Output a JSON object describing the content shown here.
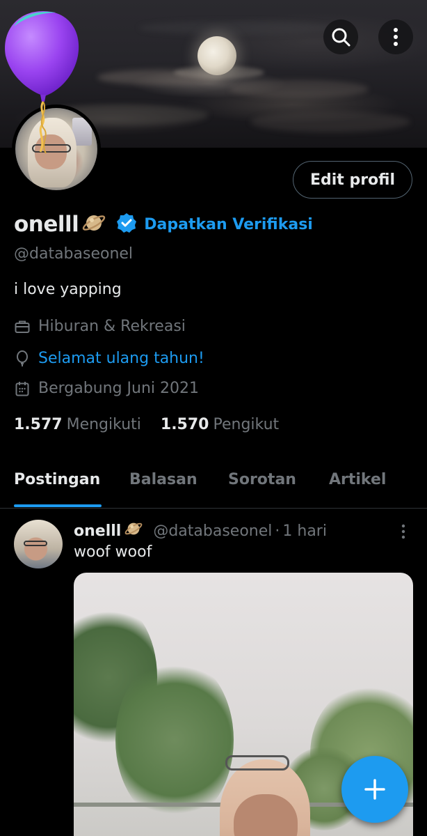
{
  "header": {
    "search_icon": "search-icon",
    "more_icon": "more-vertical-icon"
  },
  "profile": {
    "name": "onelll",
    "name_emoji": "ringed-planet-icon",
    "verify_link": "Dapatkan Verifikasi",
    "handle": "@databaseonel",
    "bio": "i love yapping",
    "edit_button": "Edit profil",
    "category": "Hiburan & Rekreasi",
    "birthday_text": "Selamat ulang tahun!",
    "joined": "Bergabung Juni 2021",
    "following_count": "1.577",
    "following_label": "Mengikuti",
    "followers_count": "1.570",
    "followers_label": "Pengikut"
  },
  "tabs": [
    {
      "label": "Postingan",
      "active": true
    },
    {
      "label": "Balasan",
      "active": false
    },
    {
      "label": "Sorotan",
      "active": false
    },
    {
      "label": "Artikel",
      "active": false
    }
  ],
  "post": {
    "author_name": "onelll",
    "author_handle": "@databaseonel",
    "separator": "·",
    "time": "1 hari",
    "text": "woof woof"
  },
  "colors": {
    "accent": "#1d9bf0",
    "background": "#000000",
    "text_primary": "#e7e9ea",
    "text_secondary": "#71767b"
  }
}
